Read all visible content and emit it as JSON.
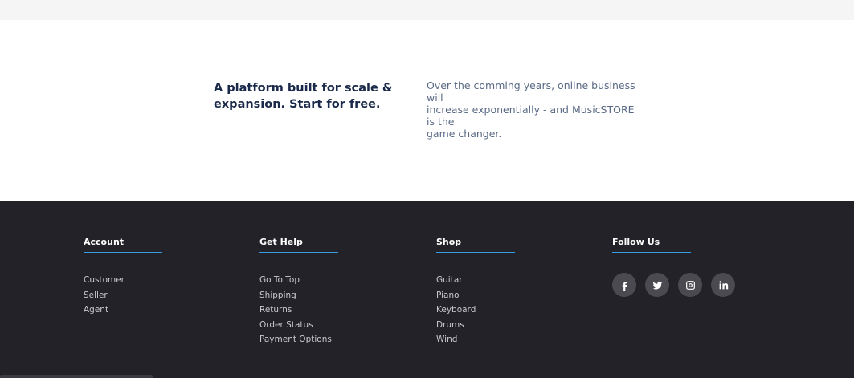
{
  "promo": {
    "heading": "A platform built for scale & expansion. Start for free.",
    "text_lines": [
      "Over the comming years, online business will",
      "increase exponentially - and MusicSTORE is the",
      "game changer."
    ]
  },
  "footer": {
    "accent_color": "#3b9be0",
    "columns": [
      {
        "title": "Account",
        "links": [
          "Customer",
          "Seller",
          "Agent"
        ]
      },
      {
        "title": "Get Help",
        "links": [
          "Go To Top",
          "Shipping",
          "Returns",
          "Order Status",
          "Payment Options"
        ]
      },
      {
        "title": "Shop",
        "links": [
          "Guitar",
          "Piano",
          "Keyboard",
          "Drums",
          "Wind"
        ]
      }
    ],
    "follow": {
      "title": "Follow Us",
      "icons": [
        "facebook-icon",
        "twitter-icon",
        "instagram-icon",
        "linkedin-icon"
      ]
    }
  }
}
